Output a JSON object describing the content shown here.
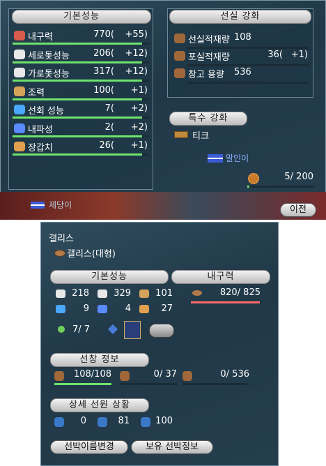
{
  "top": {
    "basic_header": "기본성능",
    "basic_rows": [
      {
        "label": "내구력",
        "value": "770(",
        "bonus": "+55)",
        "fill": 0.95
      },
      {
        "label": "세로돛성능",
        "value": "206(",
        "bonus": "+12)",
        "fill": 0.95
      },
      {
        "label": "가로돛성능",
        "value": "317(",
        "bonus": "+12)",
        "fill": 0.95
      },
      {
        "label": "조력",
        "value": "100(",
        "bonus": "+1)",
        "fill": 0.95
      },
      {
        "label": "선회 성능",
        "value": "7(",
        "bonus": "+2)",
        "fill": 0.95
      },
      {
        "label": "내파성",
        "value": "2(",
        "bonus": "+2)",
        "fill": 0.95
      },
      {
        "label": "장갑치",
        "value": "26(",
        "bonus": "+1)",
        "fill": 0.95
      }
    ],
    "cabin_header": "선실 강화",
    "cabin_rows": [
      {
        "label": "선실적재량",
        "value": "108",
        "bonus": ""
      },
      {
        "label": "포실적재량",
        "value": "36(",
        "bonus": "+1)"
      },
      {
        "label": "창고 용량",
        "value": "536",
        "bonus": ""
      }
    ],
    "special_header": "특수 강화",
    "special_item": "티크",
    "bg_text": "말인이",
    "bg_text2": "제당이",
    "counter": "5/ 200",
    "prev_button": "이전"
  },
  "bottom": {
    "ship_class": "갤리스",
    "ship_name": "갤리스(대형)",
    "basic_header": "기본성능",
    "stats": [
      {
        "icon": "fore-aft-sail-icon",
        "value": "218"
      },
      {
        "icon": "square-sail-icon",
        "value": "329"
      },
      {
        "icon": "oar-icon",
        "value": "101"
      },
      {
        "icon": "turn-icon",
        "value": "9"
      },
      {
        "icon": "wave-icon",
        "value": "4"
      },
      {
        "icon": "armor-icon",
        "value": "27"
      }
    ],
    "slot_value": "7/ 7",
    "durability_header": "내구력",
    "durability_value": "820/ 825",
    "cabin_header": "선창 정보",
    "cabin": [
      "108/108",
      "0/ 37",
      "0/ 536"
    ],
    "crew_header": "상세 선원 상황",
    "crew": [
      "0",
      "81",
      "100"
    ],
    "rename_button": "선박이름변경",
    "owned_button": "보유 선박정보"
  },
  "colors": {
    "bar_green": "#6ee36e",
    "bar_red": "#ff6b6b",
    "panel": "#23394a"
  }
}
